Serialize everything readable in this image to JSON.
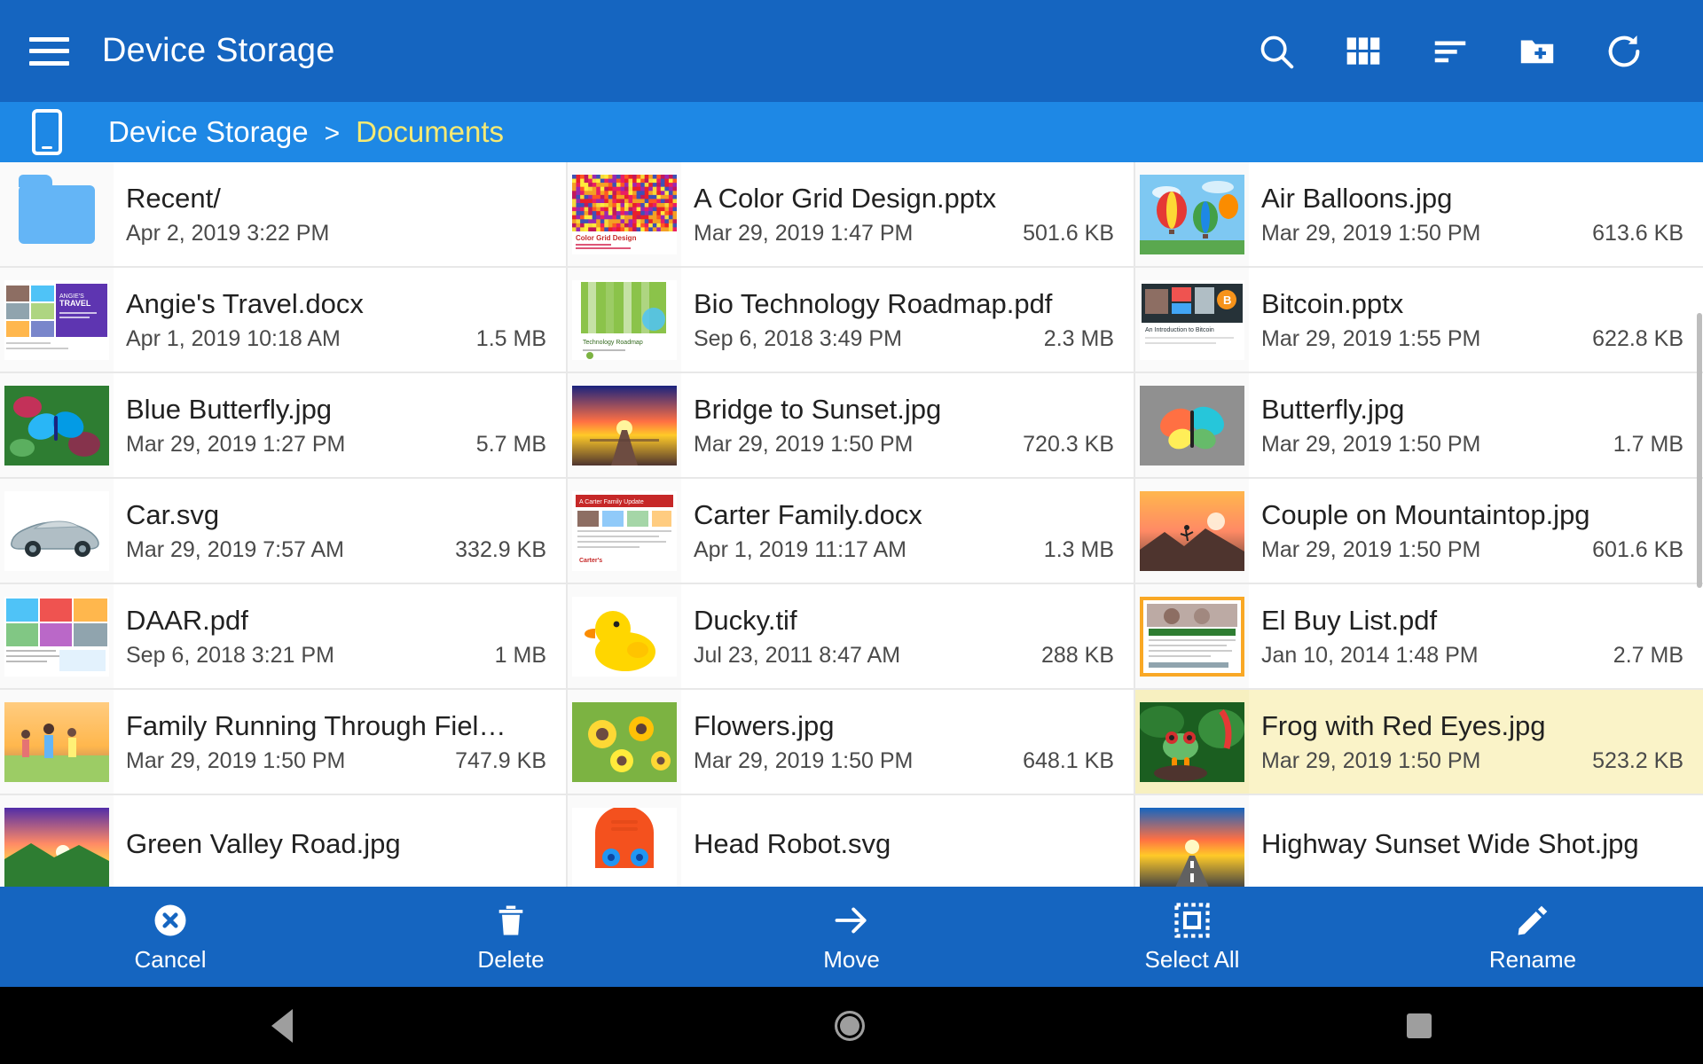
{
  "appbar": {
    "title": "Device Storage",
    "menu_icon": "hamburger-menu-icon",
    "actions": [
      {
        "name": "search",
        "icon": "search-icon"
      },
      {
        "name": "grid-view",
        "icon": "grid-view-icon"
      },
      {
        "name": "sort",
        "icon": "sort-icon"
      },
      {
        "name": "new-folder",
        "icon": "new-folder-icon"
      },
      {
        "name": "refresh",
        "icon": "refresh-icon"
      }
    ]
  },
  "breadcrumb": {
    "device_icon": "phone-icon",
    "root": "Device Storage",
    "separator": ">",
    "current": "Documents",
    "current_color": "#f6ea73"
  },
  "files": [
    {
      "name": "Recent/",
      "date": "Apr 2, 2019 3:22 PM",
      "size": "",
      "kind": "folder",
      "selected": false
    },
    {
      "name": "A Color Grid Design.pptx",
      "date": "Mar 29, 2019 1:47 PM",
      "size": "501.6 KB",
      "kind": "pptx-colorgrid",
      "selected": false
    },
    {
      "name": "Air Balloons.jpg",
      "date": "Mar 29, 2019 1:50 PM",
      "size": "613.6 KB",
      "kind": "img-balloons",
      "selected": false
    },
    {
      "name": "Angie's Travel.docx",
      "date": "Apr 1, 2019 10:18 AM",
      "size": "1.5 MB",
      "kind": "docx-travel",
      "selected": false
    },
    {
      "name": "Bio Technology Roadmap.pdf",
      "date": "Sep 6, 2018 3:49 PM",
      "size": "2.3 MB",
      "kind": "pdf-bamboo",
      "selected": false
    },
    {
      "name": "Bitcoin.pptx",
      "date": "Mar 29, 2019 1:55 PM",
      "size": "622.8 KB",
      "kind": "pptx-bitcoin",
      "selected": false
    },
    {
      "name": "Blue Butterfly.jpg",
      "date": "Mar 29, 2019 1:27 PM",
      "size": "5.7 MB",
      "kind": "img-bluebutterfly",
      "selected": false
    },
    {
      "name": "Bridge to Sunset.jpg",
      "date": "Mar 29, 2019 1:50 PM",
      "size": "720.3 KB",
      "kind": "img-bridge",
      "selected": false
    },
    {
      "name": "Butterfly.jpg",
      "date": "Mar 29, 2019 1:50 PM",
      "size": "1.7 MB",
      "kind": "img-butterfly",
      "selected": false
    },
    {
      "name": "Car.svg",
      "date": "Mar 29, 2019 7:57 AM",
      "size": "332.9 KB",
      "kind": "svg-car",
      "selected": false
    },
    {
      "name": "Carter Family.docx",
      "date": "Apr 1, 2019 11:17 AM",
      "size": "1.3 MB",
      "kind": "docx-carter",
      "selected": false
    },
    {
      "name": "Couple on Mountaintop.jpg",
      "date": "Mar 29, 2019 1:50 PM",
      "size": "601.6 KB",
      "kind": "img-mountaintop",
      "selected": false
    },
    {
      "name": "DAAR.pdf",
      "date": "Sep 6, 2018 3:21 PM",
      "size": "1 MB",
      "kind": "pdf-daar",
      "selected": false
    },
    {
      "name": "Ducky.tif",
      "date": "Jul 23, 2011 8:47 AM",
      "size": "288 KB",
      "kind": "img-ducky",
      "selected": false
    },
    {
      "name": "El Buy List.pdf",
      "date": "Jan 10, 2014 1:48 PM",
      "size": "2.7 MB",
      "kind": "pdf-elbuy",
      "selected": false
    },
    {
      "name": "Family Running Through Fiel…",
      "date": "Mar 29, 2019 1:50 PM",
      "size": "747.9 KB",
      "kind": "img-family",
      "selected": false
    },
    {
      "name": "Flowers.jpg",
      "date": "Mar 29, 2019 1:50 PM",
      "size": "648.1 KB",
      "kind": "img-flowers",
      "selected": false
    },
    {
      "name": "Frog with Red Eyes.jpg",
      "date": "Mar 29, 2019 1:50 PM",
      "size": "523.2 KB",
      "kind": "img-frog",
      "selected": true
    },
    {
      "name": "Green Valley Road.jpg",
      "date": "",
      "size": "",
      "kind": "img-greenvalley",
      "selected": false
    },
    {
      "name": "Head Robot.svg",
      "date": "",
      "size": "",
      "kind": "svg-robot",
      "selected": false
    },
    {
      "name": "Highway Sunset Wide Shot.jpg",
      "date": "",
      "size": "",
      "kind": "img-highway",
      "selected": false
    }
  ],
  "actionbar": {
    "buttons": [
      {
        "label": "Cancel",
        "icon": "cancel-circle-x-icon"
      },
      {
        "label": "Delete",
        "icon": "trash-icon"
      },
      {
        "label": "Move",
        "icon": "arrow-right-icon"
      },
      {
        "label": "Select All",
        "icon": "select-all-icon"
      },
      {
        "label": "Rename",
        "icon": "pencil-icon"
      }
    ]
  },
  "navbar": {
    "back": "back-triangle-icon",
    "home": "home-circle-icon",
    "recents": "recents-square-icon"
  },
  "colors": {
    "appbar": "#1565c0",
    "breadcrumb": "#1e88e5",
    "selection": "#faf3c8",
    "accent_yellow": "#f6ea73"
  }
}
